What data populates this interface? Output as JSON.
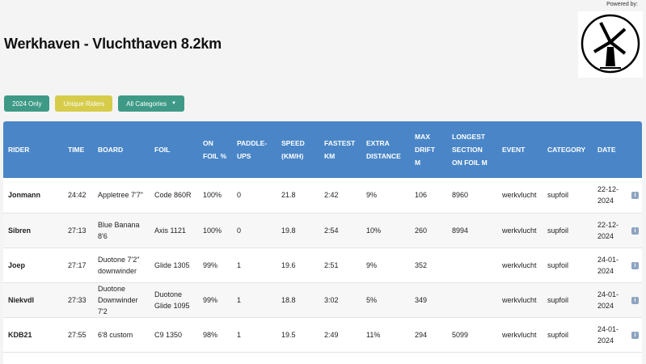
{
  "powered_by": "Powered by:",
  "page_title": "Werkhaven - Vluchthaven 8.2km",
  "filters": {
    "year_label": "2024 Only",
    "unique_label": "Unique Riders",
    "category_label": "All Categories"
  },
  "columns": [
    "RIDER",
    "TIME",
    "BOARD",
    "FOIL",
    "ON FOIL %",
    "PADDLE-UPS",
    "SPEED (KM/H)",
    "FASTEST KM",
    "EXTRA DISTANCE",
    "MAX DRIFT M",
    "LONGEST SECTION ON FOIL M",
    "EVENT",
    "CATEGORY",
    "DATE"
  ],
  "rows": [
    [
      "Jonmann",
      "24:42",
      "Appletree 7'7\"",
      "Code 860R",
      "100%",
      "0",
      "21.8",
      "2:42",
      "9%",
      "106",
      "8960",
      "werkvlucht",
      "supfoil",
      "22-12-2024"
    ],
    [
      "Sibren",
      "27:13",
      "Blue Banana 8'6",
      "Axis 1121",
      "100%",
      "0",
      "19.8",
      "2:54",
      "10%",
      "260",
      "8994",
      "werkvlucht",
      "supfoil",
      "22-12-2024"
    ],
    [
      "Joep",
      "27:17",
      "Duotone 7'2\" downwinder",
      "Glide 1305",
      "99%",
      "1",
      "19.6",
      "2:51",
      "9%",
      "352",
      "",
      "werkvlucht",
      "supfoil",
      "24-01-2024"
    ],
    [
      "Niekvdl",
      "27:33",
      "Duotone Downwinder 7'2",
      "Duotone Glide 1095",
      "99%",
      "1",
      "18.8",
      "3:02",
      "5%",
      "349",
      "",
      "werkvlucht",
      "supfoil",
      "24-01-2024"
    ],
    [
      "KDB21",
      "27:55",
      "6'8 custom",
      "C9 1350",
      "98%",
      "1",
      "19.5",
      "2:49",
      "11%",
      "294",
      "5099",
      "werkvlucht",
      "supfoil",
      "24-01-2024"
    ]
  ],
  "logo_icon": "windmill-logo-icon",
  "row_icon": "info-icon",
  "colors": {
    "header": "#4a86c7",
    "teal": "#3e9a86",
    "yellow": "#d6cc4a"
  }
}
